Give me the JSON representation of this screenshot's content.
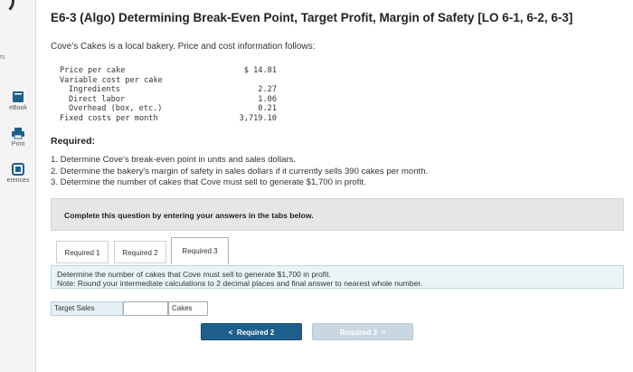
{
  "sidebar": {
    "top_fragment": "ts",
    "items": [
      {
        "label": "eBook"
      },
      {
        "label": "Print"
      },
      {
        "label": "erences"
      }
    ]
  },
  "problem": {
    "title": "E6-3 (Algo) Determining Break-Even Point, Target Profit, Margin of Safety [LO 6-1, 6-2, 6-3]",
    "intro": "Cove's Cakes is a local bakery. Price and cost information follows:"
  },
  "cost_table": [
    {
      "label": "Price per cake",
      "value": "$ 14.81",
      "indent": 0
    },
    {
      "label": "Variable cost per cake",
      "value": "",
      "indent": 0
    },
    {
      "label": "Ingredients",
      "value": "2.27",
      "indent": 1
    },
    {
      "label": "Direct labor",
      "value": "1.06",
      "indent": 1
    },
    {
      "label": "Overhead (box, etc.)",
      "value": "0.21",
      "indent": 1
    },
    {
      "label": "Fixed costs per month",
      "value": "3,719.10",
      "indent": 0
    }
  ],
  "required": {
    "heading": "Required:",
    "items": [
      "1. Determine Cove's break-even point in units and sales dollars.",
      "2. Determine the bakery's margin of safety in sales dollars if it currently sells 390 cakes per month.",
      "3. Determine the number of cakes that Cove must sell to generate $1,700 in profit."
    ]
  },
  "instruction": "Complete this question by entering your answers in the tabs below.",
  "tabs": [
    {
      "label": "Required 1",
      "active": false
    },
    {
      "label": "Required 2",
      "active": false
    },
    {
      "label": "Required 3",
      "active": true
    }
  ],
  "task": {
    "line1": "Determine the number of cakes that Cove must sell to generate $1,700 in profit.",
    "line2": "Note: Round your intermediate calculations to 2 decimal places and final answer to nearest whole number."
  },
  "answer": {
    "label": "Target Sales",
    "value": "",
    "unit": "Cakes"
  },
  "nav": {
    "prev_label": "Required 2",
    "next_label": "Required 3",
    "prev_glyph": "<",
    "next_glyph": ">"
  },
  "colors": {
    "primary_button": "#1f5f8b",
    "disabled_button": "#c9d7e2",
    "task_background": "#eaf3f6"
  }
}
